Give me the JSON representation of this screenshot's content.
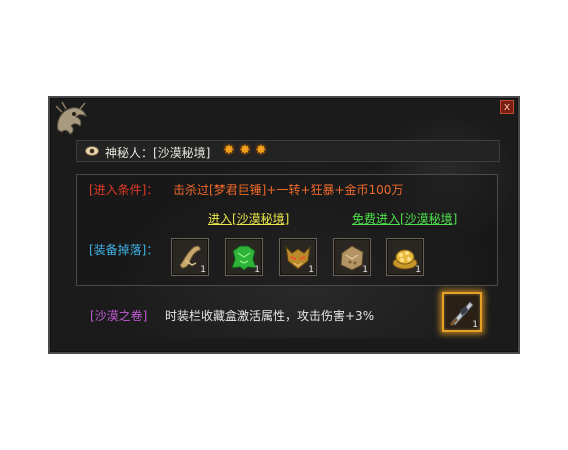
{
  "header": {
    "title": "神秘人：[沙漠秘境]",
    "star_count": 3,
    "star_symbol": "✸"
  },
  "close_label": "x",
  "conditions": {
    "label": "[进入条件]：",
    "text": "击杀过[梦君巨锤]+一转+狂暴+金币100万"
  },
  "links": {
    "enter": "进入[沙漠秘境]",
    "free_enter": "免费进入[沙漠秘境]"
  },
  "drops": {
    "label": "[装备掉落]：",
    "items": [
      {
        "icon": "bone-horn-icon",
        "qty": "1"
      },
      {
        "icon": "green-armor-icon",
        "qty": "1"
      },
      {
        "icon": "demon-helmet-icon",
        "qty": "1"
      },
      {
        "icon": "treasure-pouch-icon",
        "qty": "1"
      },
      {
        "icon": "gold-coins-icon",
        "qty": "1"
      }
    ]
  },
  "scroll": {
    "label": "[沙漠之卷]",
    "text": "时装栏收藏盒激活属性，攻击伤害+3%"
  },
  "reward": {
    "icon": "reward-weapon-icon",
    "qty": "1"
  },
  "colors": {
    "condition_label": "#e23a28",
    "condition_text": "#ef6a2a",
    "enter_link": "#eae54a",
    "free_link": "#4ee04a",
    "drops_label": "#3fb4e8",
    "scroll_label": "#c35ad6",
    "star": "#f0a21a"
  }
}
